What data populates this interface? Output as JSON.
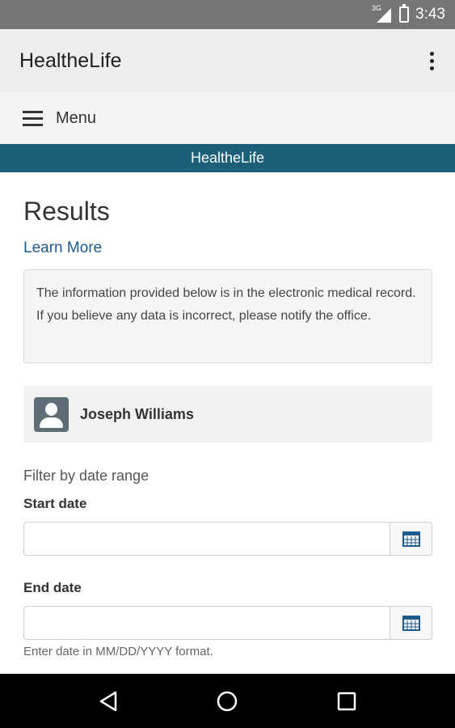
{
  "status_bar": {
    "network": "3G",
    "time": "3:43"
  },
  "app_bar": {
    "title": "HealtheLife"
  },
  "menu": {
    "label": "Menu"
  },
  "banner": {
    "text": "HealtheLife"
  },
  "main": {
    "title": "Results",
    "learn_more": "Learn More",
    "info_text": "The information provided below is in the electronic medical record. If you believe any data is incorrect, please notify the office.",
    "person": {
      "name": "Joseph Williams"
    },
    "filter": {
      "heading": "Filter by date range",
      "start_label": "Start date",
      "start_value": "",
      "end_label": "End date",
      "end_value": "",
      "hint": "Enter date in MM/DD/YYYY format."
    }
  },
  "colors": {
    "banner": "#1b5f79",
    "link": "#1d5b8e",
    "avatar": "#5e6d76",
    "calendar_icon": "#1d5b8e"
  },
  "icons": [
    "signal-icon",
    "battery-icon",
    "overflow-menu-icon",
    "hamburger-icon",
    "user-avatar-icon",
    "calendar-icon",
    "back-icon",
    "home-icon",
    "recents-icon"
  ]
}
